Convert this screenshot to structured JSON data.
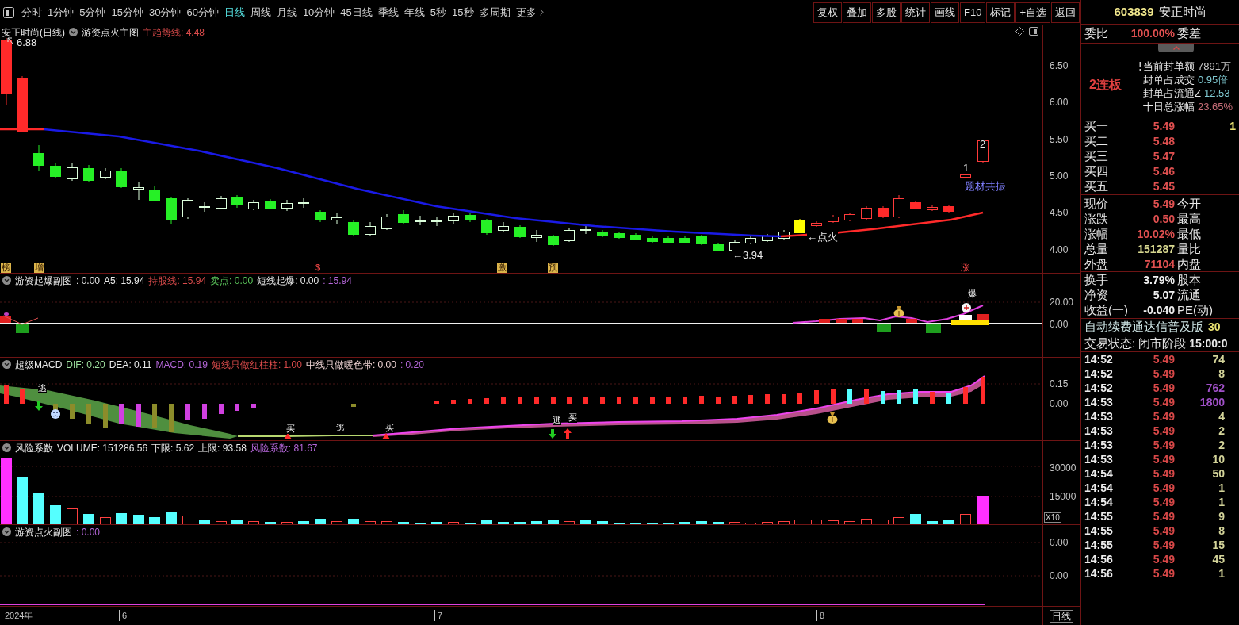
{
  "toolbar": {
    "periods": [
      {
        "label": "分时",
        "selected": false
      },
      {
        "label": "1分钟",
        "selected": false
      },
      {
        "label": "5分钟",
        "selected": false
      },
      {
        "label": "15分钟",
        "selected": false
      },
      {
        "label": "30分钟",
        "selected": false
      },
      {
        "label": "60分钟",
        "selected": false
      },
      {
        "label": "日线",
        "selected": true
      },
      {
        "label": "周线",
        "selected": false
      },
      {
        "label": "月线",
        "selected": false
      },
      {
        "label": "10分钟",
        "selected": false
      },
      {
        "label": "45日线",
        "selected": false
      },
      {
        "label": "季线",
        "selected": false
      },
      {
        "label": "年线",
        "selected": false
      },
      {
        "label": "5秒",
        "selected": false
      },
      {
        "label": "15秒",
        "selected": false
      },
      {
        "label": "多周期",
        "selected": false
      }
    ],
    "more_menu": {
      "label": "更多"
    },
    "buttons": [
      "复权",
      "叠加",
      "多股",
      "统计",
      "画线",
      "F10",
      "标记",
      "+自选",
      "返回"
    ]
  },
  "main_chart": {
    "title": "安正时尚(日线)",
    "indicator": "游资点火主图",
    "readouts": [
      {
        "text": "主趋势线: 4.48",
        "color": "#d84a4a"
      }
    ],
    "axis": [
      "6.50",
      "6.00",
      "5.50",
      "5.00",
      "4.50",
      "4.00"
    ],
    "annotations": [
      {
        "text": "6.88",
        "kind": "plain"
      },
      {
        "text": "2",
        "kind": "plain"
      },
      {
        "text": "1",
        "kind": "plain"
      },
      {
        "text": "题材共振",
        "kind": "theme"
      },
      {
        "text": "←点火",
        "kind": "plain"
      },
      {
        "text": "←3.94",
        "kind": "plain"
      }
    ],
    "signals": [
      {
        "text": "榜",
        "kind": "tag"
      },
      {
        "text": "增",
        "kind": "tag"
      },
      {
        "text": "$",
        "kind": "mark"
      },
      {
        "text": "激",
        "kind": "tag"
      },
      {
        "text": "预",
        "kind": "tag"
      },
      {
        "text": "涨",
        "kind": "mark"
      }
    ]
  },
  "panes": [
    {
      "kind": "burst",
      "title": "游资起爆副图",
      "readouts": [
        {
          "text": ": 0.00",
          "color": "#e8e8e8"
        },
        {
          "text": "A5: 15.94",
          "color": "#e8e8e8"
        },
        {
          "text": "持股线: 15.94",
          "color": "#d84a4a"
        },
        {
          "text": "卖点: 0.00",
          "color": "#5cc85c"
        },
        {
          "text": "短线起爆: 0.00",
          "color": "#e8e8e8"
        },
        {
          "text": ": 15.94",
          "color": "#b466d8"
        }
      ],
      "labels": [
        "爆"
      ],
      "axis": [
        "20.00",
        "0.00"
      ]
    },
    {
      "kind": "macd",
      "title": "超级MACD",
      "readouts": [
        {
          "text": "DIF: 0.20",
          "color": "#9fe09f"
        },
        {
          "text": "DEA: 0.11",
          "color": "#e8e8e8"
        },
        {
          "text": "MACD: 0.19",
          "color": "#b466d8"
        },
        {
          "text": "短线只做红柱柱: 1.00",
          "color": "#d84a4a"
        },
        {
          "text": "中线只做暖色带: 0.00",
          "color": "#f0d4d4"
        },
        {
          "text": ": 0.20",
          "color": "#b466d8"
        }
      ],
      "labels": [
        "逃",
        "买",
        "逃",
        "买",
        "逃",
        "买"
      ],
      "axis": [
        "0.15",
        "0.00"
      ]
    },
    {
      "kind": "volume",
      "title": "风险系数",
      "readouts": [
        {
          "text": "VOLUME: 151286.56",
          "color": "#e8e8e8"
        },
        {
          "text": "下限: 5.62",
          "color": "#e8e8e8"
        },
        {
          "text": "上限: 93.58",
          "color": "#e8e8e8"
        },
        {
          "text": "风险系数: 81.67",
          "color": "#b466d8"
        }
      ],
      "axis": [
        "30000",
        "15000"
      ],
      "scale": "X10"
    },
    {
      "kind": "ignite",
      "title": "游资点火副图",
      "readouts": [
        {
          "text": ": 0.00",
          "color": "#b466d8"
        }
      ],
      "axis": [
        "0.00",
        "0.00"
      ]
    }
  ],
  "date_axis": {
    "labels": [
      "2024年",
      "6",
      "7",
      "8"
    ],
    "period": "日线"
  },
  "quote": {
    "code": "603839",
    "name": "安正时尚",
    "ratio_label": "委比",
    "ratio_value": "100.00%",
    "diff_label": "委差",
    "streak": "2连板",
    "seal_stats": [
      {
        "label": "当前封单额",
        "value": "7891万",
        "color": "#c8c8c8",
        "alert": true
      },
      {
        "label": "封单占成交",
        "value": "0.95倍",
        "color": "#7fc8d0",
        "alert": false
      },
      {
        "label": "封单占流通Z",
        "value": "12.53",
        "color": "#7fc8d0",
        "alert": false
      },
      {
        "label": "十日总涨幅",
        "value": "23.65%",
        "color": "#c86e78",
        "alert": false
      }
    ],
    "bids": [
      {
        "label": "买一",
        "price": "5.49",
        "volume": "1"
      },
      {
        "label": "买二",
        "price": "5.48"
      },
      {
        "label": "买三",
        "price": "5.47"
      },
      {
        "label": "买四",
        "price": "5.46"
      },
      {
        "label": "买五",
        "price": "5.45"
      }
    ],
    "stats": [
      {
        "label": "现价",
        "value": "5.49",
        "color": "#e05050",
        "label2": "今开"
      },
      {
        "label": "涨跌",
        "value": "0.50",
        "color": "#e05050",
        "label2": "最高"
      },
      {
        "label": "涨幅",
        "value": "10.02%",
        "color": "#e05050",
        "label2": "最低"
      },
      {
        "label": "总量",
        "value": "151287",
        "color": "#d8d890",
        "label2": "量比"
      },
      {
        "label": "外盘",
        "value": "71104",
        "color": "#e05050",
        "label2": "内盘"
      }
    ],
    "fundamentals": [
      {
        "label": "换手",
        "value": "3.79%",
        "label2": "股本"
      },
      {
        "label": "净资",
        "value": "5.07",
        "label2": "流通"
      },
      {
        "label": "收益(一)",
        "value": "-0.040",
        "label2": "PE(动)"
      }
    ],
    "notice": {
      "text": "自动续费通达信普及版",
      "value": "30"
    },
    "status": {
      "label": "交易状态:",
      "phase": "闭市阶段",
      "time": "15:00:0"
    },
    "ticks": [
      {
        "time": "14:52",
        "price": "5.49",
        "volume": "74",
        "large": false
      },
      {
        "time": "14:52",
        "price": "5.49",
        "volume": "8",
        "large": false
      },
      {
        "time": "14:52",
        "price": "5.49",
        "volume": "762",
        "large": true
      },
      {
        "time": "14:53",
        "price": "5.49",
        "volume": "1800",
        "large": true
      },
      {
        "time": "14:53",
        "price": "5.49",
        "volume": "4",
        "large": false
      },
      {
        "time": "14:53",
        "price": "5.49",
        "volume": "2",
        "large": false
      },
      {
        "time": "14:53",
        "price": "5.49",
        "volume": "2",
        "large": false
      },
      {
        "time": "14:53",
        "price": "5.49",
        "volume": "10",
        "large": false
      },
      {
        "time": "14:54",
        "price": "5.49",
        "volume": "50",
        "large": false
      },
      {
        "time": "14:54",
        "price": "5.49",
        "volume": "1",
        "large": false
      },
      {
        "time": "14:54",
        "price": "5.49",
        "volume": "1",
        "large": false
      },
      {
        "time": "14:55",
        "price": "5.49",
        "volume": "9",
        "large": false
      },
      {
        "time": "14:55",
        "price": "5.49",
        "volume": "8",
        "large": false
      },
      {
        "time": "14:55",
        "price": "5.49",
        "volume": "15",
        "large": false
      },
      {
        "time": "14:56",
        "price": "5.49",
        "volume": "45",
        "large": false
      },
      {
        "time": "14:56",
        "price": "5.49",
        "volume": "1",
        "large": false
      }
    ]
  }
}
